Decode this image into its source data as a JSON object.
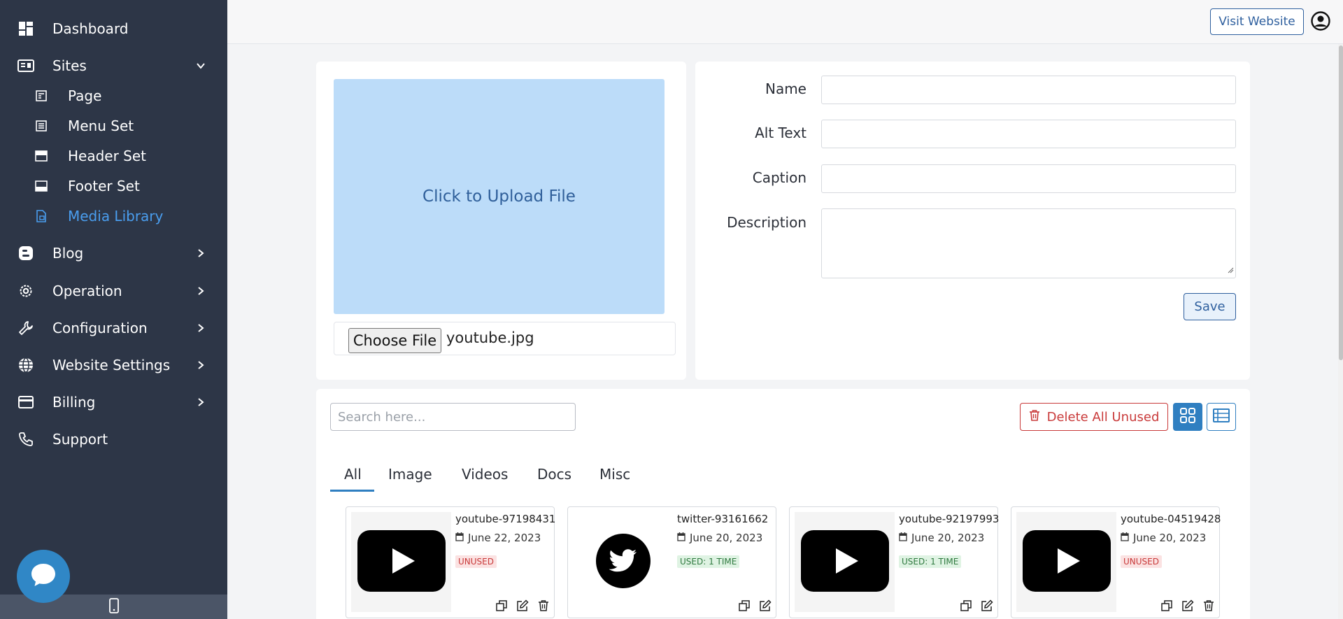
{
  "sidebar": {
    "items": [
      {
        "label": "Dashboard",
        "icon": "dashboard-icon"
      },
      {
        "label": "Sites",
        "icon": "sites-icon",
        "expanded": true
      },
      {
        "label": "Blog",
        "icon": "blog-icon"
      },
      {
        "label": "Operation",
        "icon": "gear-icon"
      },
      {
        "label": "Configuration",
        "icon": "wrench-icon"
      },
      {
        "label": "Website Settings",
        "icon": "globe-icon"
      },
      {
        "label": "Billing",
        "icon": "credit-card-icon"
      },
      {
        "label": "Support",
        "icon": "phone-icon"
      }
    ],
    "sub_items": [
      {
        "label": "Page"
      },
      {
        "label": "Menu Set"
      },
      {
        "label": "Header Set"
      },
      {
        "label": "Footer Set"
      },
      {
        "label": "Media Library",
        "active": true
      }
    ]
  },
  "header": {
    "visit_label": "Visit Website"
  },
  "upload": {
    "zone_label": "Click to Upload File",
    "choose_label": "Choose File",
    "file_name": "youtube.jpg"
  },
  "form": {
    "name_label": "Name",
    "alt_label": "Alt Text",
    "caption_label": "Caption",
    "description_label": "Description",
    "save_label": "Save"
  },
  "library": {
    "search_placeholder": "Search here...",
    "delete_label": "Delete All Unused",
    "tabs": [
      {
        "label": "All",
        "active": true
      },
      {
        "label": "Image"
      },
      {
        "label": "Videos"
      },
      {
        "label": "Docs"
      },
      {
        "label": "Misc"
      }
    ],
    "items": [
      {
        "name": "youtube-97198431",
        "date": "June 22, 2023",
        "status": "UNUSED",
        "type": "youtube"
      },
      {
        "name": "twitter-93161662",
        "date": "June 20, 2023",
        "status": "USED: 1 TIME",
        "type": "twitter"
      },
      {
        "name": "youtube-92197993",
        "date": "June 20, 2023",
        "status": "USED: 1 TIME",
        "type": "youtube"
      },
      {
        "name": "youtube-04519428",
        "date": "June 20, 2023",
        "status": "UNUSED",
        "type": "youtube"
      }
    ]
  },
  "colors": {
    "sidebar_bg": "#2d3647",
    "accent": "#2f7fc1",
    "active_link": "#4a9eef",
    "danger": "#c93a3a",
    "upload_zone": "#bcdcf9"
  }
}
